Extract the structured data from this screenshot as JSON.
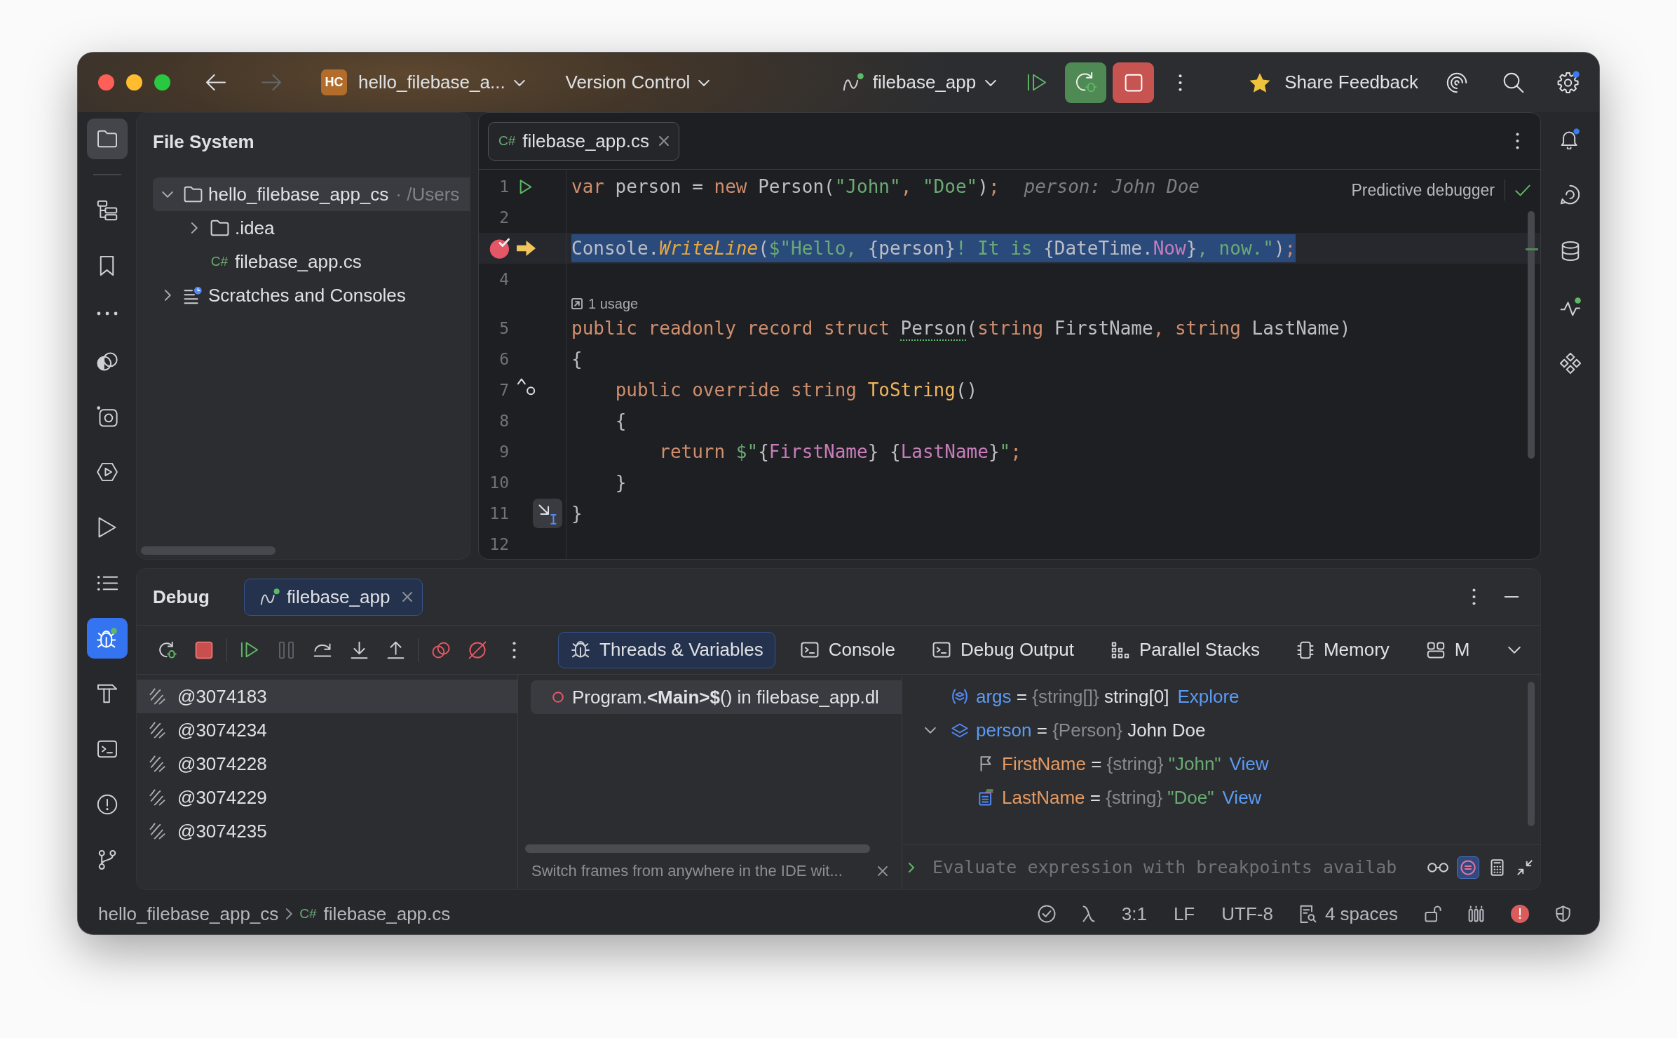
{
  "title_bar": {
    "navigation": [
      {
        "disabled": false
      },
      {
        "disabled": true
      }
    ],
    "project_badge": "HC",
    "project": "hello_filebase_a...",
    "vcs": "Version Control",
    "run_config": "filebase_app",
    "feedback": "Share Feedback"
  },
  "left_toolbar": [
    {
      "selected": true,
      "focused": false
    },
    {
      "selected": false,
      "focused": false
    },
    {
      "selected": false,
      "focused": false
    },
    {
      "selected": false,
      "focused": false
    },
    {
      "selected": false,
      "focused": false
    },
    {
      "selected": false,
      "focused": false
    },
    {
      "selected": false,
      "focused": false
    },
    {
      "selected": false,
      "focused": false
    },
    {
      "selected": false,
      "focused": false
    },
    {
      "selected": true,
      "focused": true
    },
    {
      "selected": false,
      "focused": false
    },
    {
      "selected": false,
      "focused": false
    },
    {
      "selected": false,
      "focused": false
    },
    {
      "selected": false,
      "focused": false
    }
  ],
  "project_panel": {
    "title": "File System",
    "tree": [
      {
        "kind": "folder",
        "label": "hello_filebase_app_cs",
        "path": "· /Users",
        "expanded": true,
        "selected": true,
        "children": [
          {
            "kind": "folder",
            "label": ".idea",
            "expanded": false,
            "selected": false
          },
          {
            "kind": "file",
            "file_type": "C#",
            "label": "filebase_app.cs",
            "selected": false
          }
        ]
      },
      {
        "kind": "scratches",
        "label": "Scratches and Consoles",
        "expanded": false,
        "selected": false
      }
    ]
  },
  "editor": {
    "tabs": [
      {
        "file_type": "C#",
        "label": "filebase_app.cs",
        "selected": true
      }
    ],
    "predictive_debugger": {
      "label": "Predictive debugger",
      "enabled": true
    },
    "lines": [
      {
        "number": "1",
        "markers": [
          {
            "kind": "run"
          }
        ],
        "tokens": [
          {
            "text": "var",
            "kind": "keyword"
          },
          {
            "text": " person = ",
            "kind": "plain"
          },
          {
            "text": "new",
            "kind": "keyword"
          },
          {
            "text": " Person(",
            "kind": "plain"
          },
          {
            "text": "\"John\"",
            "kind": "string"
          },
          {
            "text": ", ",
            "kind": "punct"
          },
          {
            "text": "\"Doe\"",
            "kind": "string"
          },
          {
            "text": ")",
            "kind": "plain"
          },
          {
            "text": ";",
            "kind": "punct"
          }
        ],
        "inlay": "person: John Doe"
      },
      {
        "number": "2"
      },
      {
        "markers": [
          {
            "kind": "breakpoint"
          },
          {
            "kind": "execution_point"
          }
        ],
        "tokens": [
          {
            "text": "Console.",
            "kind": "plain"
          },
          {
            "text": "WriteLine",
            "kind": "call"
          },
          {
            "text": "(",
            "kind": "plain"
          },
          {
            "text": "$\"Hello, ",
            "kind": "string"
          },
          {
            "text": "{person}",
            "kind": "plain"
          },
          {
            "text": "! It is ",
            "kind": "string"
          },
          {
            "text": "{DateTime.",
            "kind": "plain"
          },
          {
            "text": "Now",
            "kind": "member"
          },
          {
            "text": "}",
            "kind": "plain"
          },
          {
            "text": ", now.\"",
            "kind": "string"
          },
          {
            "text": ")",
            "kind": "plain"
          },
          {
            "text": ";",
            "kind": "punct"
          }
        ]
      },
      {
        "number": "4"
      },
      {
        "number": "5",
        "hint": "1 usage",
        "tokens": [
          {
            "text": "public readonly record struct ",
            "kind": "keyword"
          },
          {
            "text": "Person",
            "kind": "warning"
          },
          {
            "text": "(",
            "kind": "plain"
          },
          {
            "text": "string",
            "kind": "keyword"
          },
          {
            "text": " FirstName",
            "kind": "plain"
          },
          {
            "text": ", ",
            "kind": "punct"
          },
          {
            "text": "string",
            "kind": "keyword"
          },
          {
            "text": " LastName)",
            "kind": "plain"
          }
        ]
      },
      {
        "number": "6",
        "tokens": [
          {
            "text": "{",
            "kind": "plain"
          }
        ]
      },
      {
        "number": "7",
        "markers": [
          {
            "kind": "override"
          }
        ],
        "tokens": [
          {
            "text": "    public override string ",
            "kind": "keyword"
          },
          {
            "text": "ToString",
            "kind": "method"
          },
          {
            "text": "()",
            "kind": "plain"
          }
        ]
      },
      {
        "number": "8",
        "tokens": [
          {
            "text": "    {",
            "kind": "plain"
          }
        ]
      },
      {
        "number": "9",
        "tokens": [
          {
            "text": "        return ",
            "kind": "keyword"
          },
          {
            "text": "$\"",
            "kind": "string"
          },
          {
            "text": "{",
            "kind": "plain"
          },
          {
            "text": "FirstName",
            "kind": "member"
          },
          {
            "text": "} {",
            "kind": "plain"
          },
          {
            "text": "LastName",
            "kind": "member"
          },
          {
            "text": "}",
            "kind": "plain"
          },
          {
            "text": "\"",
            "kind": "string"
          },
          {
            "text": ";",
            "kind": "punct"
          }
        ]
      },
      {
        "number": "10",
        "tokens": [
          {
            "text": "    }",
            "kind": "plain"
          }
        ]
      },
      {
        "number": "11",
        "markers": [
          {
            "kind": "action"
          }
        ],
        "tokens": [
          {
            "text": "}",
            "kind": "plain"
          }
        ]
      },
      {
        "number": "12"
      }
    ]
  },
  "debug_panel": {
    "title": "Debug",
    "sessions": [
      {
        "label": "filebase_app",
        "selected": true
      }
    ],
    "actions": [
      {
        "disabled": false
      },
      {
        "disabled": false
      },
      {
        "disabled": false
      },
      {
        "disabled": true
      },
      {
        "disabled": false
      },
      {
        "disabled": false
      },
      {
        "disabled": false
      },
      {
        "disabled": false
      },
      {
        "disabled": false
      },
      {
        "disabled": false
      }
    ],
    "tabs": [
      {
        "label": "Threads & Variables",
        "selected": true
      },
      {
        "label": "Console",
        "selected": false
      },
      {
        "label": "Debug Output",
        "selected": false
      },
      {
        "label": "Parallel Stacks",
        "selected": false
      },
      {
        "label": "Memory",
        "selected": false
      },
      {
        "label": "M",
        "selected": false
      }
    ],
    "threads": [
      {
        "label": "@3074183",
        "selected": true
      },
      {
        "label": "@3074234",
        "selected": false
      },
      {
        "label": "@3074228",
        "selected": false
      },
      {
        "label": "@3074229",
        "selected": false
      },
      {
        "label": "@3074235",
        "selected": false
      }
    ],
    "frames": [
      {
        "label": "Program.**<Main>$**() in filebase_app.dl",
        "selected": true
      }
    ],
    "frames_hint": "Switch frames from anywhere in the IDE wit...",
    "variables": [
      {
        "kind": "parameter",
        "name": "args",
        "operator": "=",
        "type": "{string[]}",
        "value": {
          "text": "string[0]",
          "kind": "object"
        },
        "link": "Explore"
      },
      {
        "kind": "local",
        "name": "person",
        "operator": "=",
        "type": "{Person}",
        "value": {
          "text": "John Doe",
          "kind": "object"
        },
        "expanded": true,
        "children": [
          {
            "kind": "field",
            "name": "FirstName",
            "operator": "=",
            "type": "{string}",
            "value": {
              "text": "\"John\"",
              "kind": "string"
            },
            "link": "View"
          },
          {
            "kind": "property",
            "name": "LastName",
            "operator": "=",
            "type": "{string}",
            "value": {
              "text": "\"Doe\"",
              "kind": "string"
            },
            "link": "View"
          }
        ]
      }
    ],
    "evaluate": {
      "placeholder": "Evaluate expression with breakpoints availab",
      "inline_mode": true
    }
  },
  "status_bar": {
    "breadcrumbs": [
      {
        "label": "hello_filebase_app_cs"
      },
      {
        "file_type": "C#",
        "label": "filebase_app.cs"
      }
    ],
    "caret": "3:1",
    "line_separator": "LF",
    "encoding": "UTF-8",
    "indent": "4 spaces"
  }
}
